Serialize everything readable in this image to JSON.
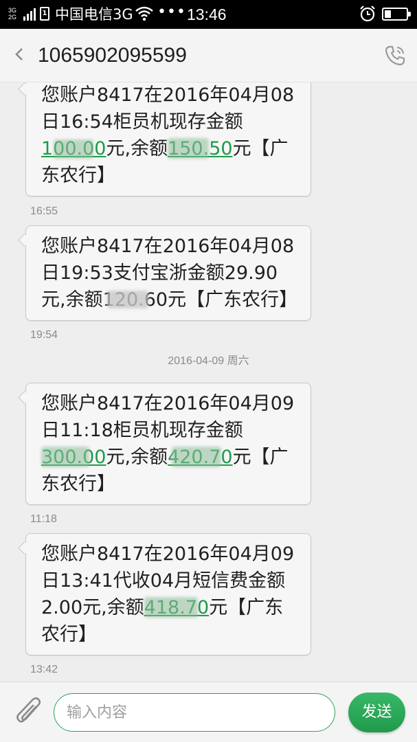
{
  "status_bar": {
    "network_top": "3G",
    "network_bottom": "2G",
    "sim_label": "1",
    "carrier": "中国电信3G",
    "more": "•••",
    "time": "13:46",
    "battery_level": 0.3
  },
  "header": {
    "title": "1065902095599",
    "icons": [
      "back-icon",
      "call-icon"
    ]
  },
  "messages": [
    {
      "parts": [
        "您账户8417在2016年04月08日16:54柜员机现存金额",
        "100.00",
        "元,余额",
        "150.50",
        "元【广东农行】"
      ],
      "time": "16:55"
    },
    {
      "parts": [
        "您账户8417在2016年04月08日19:53支付宝浙金额29.90元,余额",
        "120.60",
        "元【广东农行】"
      ],
      "time": "19:54"
    },
    {
      "parts": [
        "您账户8417在2016年04月09日11:18柜员机现存金额",
        "300.00",
        "元,余额",
        "420.70",
        "元【广东农行】"
      ],
      "time": "11:18"
    },
    {
      "parts": [
        "您账户8417在2016年04月09日13:41代收04月短信费金额2.00元,余额",
        "418.70",
        "元【广东农行】"
      ],
      "time": "13:42"
    }
  ],
  "date_separator": "2016-04-09 周六",
  "composer": {
    "placeholder": "输入内容",
    "send_label": "发送",
    "icons": [
      "attach-icon"
    ]
  },
  "colors": {
    "accent": "#1f9a4a",
    "status_bar": "#000000",
    "background": "#eeeeee"
  }
}
